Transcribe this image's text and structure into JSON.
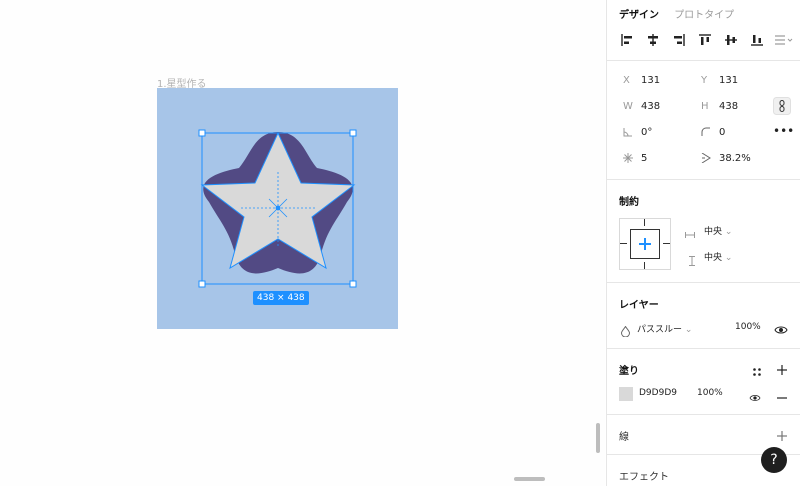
{
  "canvas": {
    "frame_label": "1.星型作る",
    "size_badge": "438 × 438",
    "frame_color": "#a7c5e8",
    "shape_fill": "#524a84",
    "star_fill": "#d9d9d9",
    "selection_color": "#1e90ff"
  },
  "panel": {
    "tabs": [
      {
        "label": "デザイン",
        "active": true
      },
      {
        "label": "プロトタイプ",
        "active": false
      }
    ],
    "align_icons": [
      "align-left-icon",
      "align-center-h-icon",
      "align-right-icon",
      "align-top-icon",
      "align-center-v-icon",
      "align-bottom-icon",
      "distribute-icon"
    ],
    "geometry": {
      "x_label": "X",
      "x_value": "131",
      "y_label": "Y",
      "y_value": "131",
      "w_label": "W",
      "w_value": "438",
      "h_label": "H",
      "h_value": "438",
      "rotation_value": "0°",
      "radius_value": "0",
      "points_value": "5",
      "ratio_value": "38.2%"
    },
    "constraints": {
      "title": "制約",
      "horizontal": "中央",
      "vertical": "中央"
    },
    "layer": {
      "title": "レイヤー",
      "blend": "パススルー",
      "opacity": "100%"
    },
    "fill": {
      "title": "塗り",
      "color_hex": "D9D9D9",
      "opacity": "100%"
    },
    "stroke": {
      "title": "線"
    },
    "effects": {
      "title": "エフェクト"
    },
    "help_label": "?"
  }
}
